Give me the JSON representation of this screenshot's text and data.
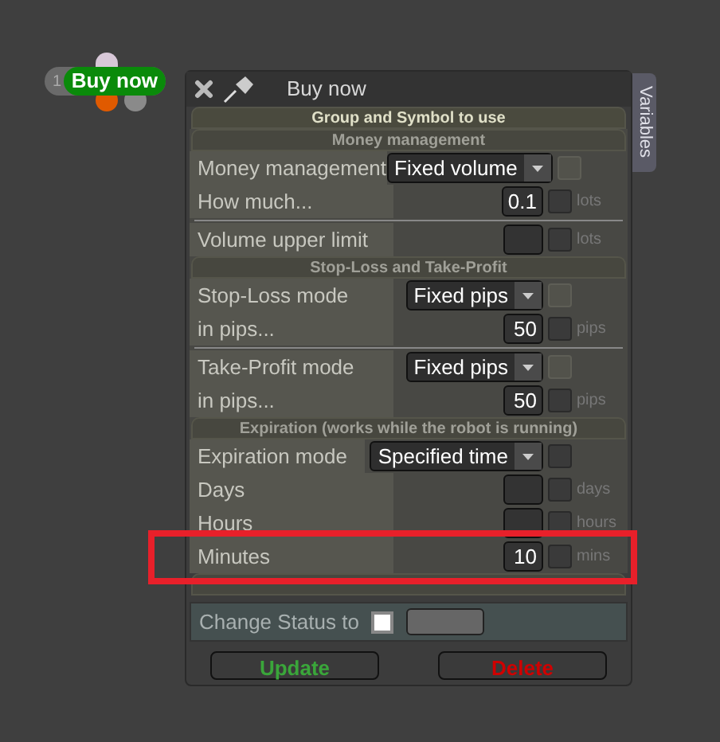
{
  "node": {
    "number": "1",
    "label": "Buy now"
  },
  "window": {
    "title": "Buy now",
    "side_tab": "Variables"
  },
  "group_header": "Group and Symbol to use",
  "sections": [
    {
      "title": "Money management",
      "rows": [
        {
          "kind": "select",
          "label": "Money management",
          "value": "Fixed volume",
          "checkbox_disabled": true,
          "checked": false
        },
        {
          "kind": "number",
          "label": "How much...",
          "value": "0.1",
          "unit": "lots",
          "checked": false,
          "divider_after": true
        },
        {
          "kind": "number",
          "label": "Volume upper limit",
          "unit": "lots",
          "checked": false
        }
      ]
    },
    {
      "title": "Stop-Loss and Take-Profit",
      "rows": [
        {
          "kind": "select",
          "label": "Stop-Loss mode",
          "value": "Fixed pips",
          "checkbox_disabled": true,
          "checked": false
        },
        {
          "kind": "number",
          "label": "in pips...",
          "value": "50",
          "unit": "pips",
          "checked": false,
          "divider_after": true
        },
        {
          "kind": "select",
          "label": "Take-Profit mode",
          "value": "Fixed pips",
          "checkbox_disabled": true,
          "checked": false
        },
        {
          "kind": "number",
          "label": "in pips...",
          "value": "50",
          "unit": "pips",
          "checked": false
        }
      ]
    },
    {
      "title": "Expiration (works while the robot is running)",
      "rows": [
        {
          "kind": "select",
          "label": "Expiration mode",
          "value": "Specified time",
          "checkbox_disabled": false,
          "checked": false
        },
        {
          "kind": "number",
          "label": "Days",
          "unit": "days",
          "checked": false
        },
        {
          "kind": "number",
          "label": "Hours",
          "unit": "hours",
          "checked": false
        },
        {
          "kind": "number",
          "label": "Minutes",
          "value": "10",
          "unit": "mins",
          "checked": false
        }
      ]
    }
  ],
  "status": {
    "label": "Change Status to",
    "checked": false
  },
  "buttons": [
    {
      "label": "Update",
      "kind": "update"
    },
    {
      "label": "Delete",
      "kind": "delete"
    }
  ]
}
